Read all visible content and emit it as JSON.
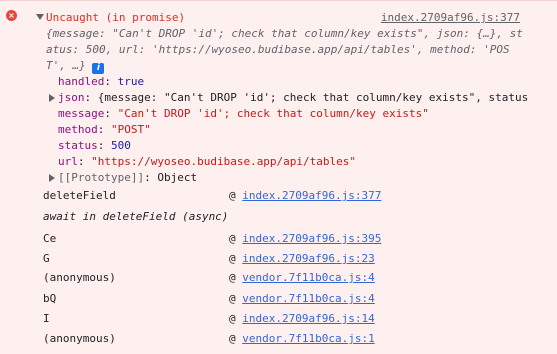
{
  "error": {
    "title": "Uncaught (in promise)",
    "source": "index.2709af96.js:377",
    "summary_line1": "{message: \"Can't DROP 'id'; check that column/key exists\", json: {…}, st",
    "summary_line2": "atus: 500, url: 'https://wyoseo.budibase.app/api/tables', method: 'POS",
    "summary_line3": "T', …}"
  },
  "properties": [
    {
      "key": "handled",
      "value": "true"
    },
    {
      "key": "json",
      "value": "{message: \"Can't DROP 'id'; check that column/key exists\", status"
    },
    {
      "key": "message",
      "value": "\"Can't DROP 'id'; check that column/key exists\""
    },
    {
      "key": "method",
      "value": "\"POST\""
    },
    {
      "key": "status",
      "value": "500"
    },
    {
      "key": "url",
      "value": "\"https://wyoseo.budibase.app/api/tables\""
    },
    {
      "key": "[[Prototype]]",
      "value": "Object"
    }
  ],
  "stack": [
    {
      "fn": "deleteField",
      "at": "@",
      "link": "index.2709af96.js:377"
    },
    {
      "fn": "await in deleteField (async)",
      "at": "",
      "link": ""
    },
    {
      "fn": "Ce",
      "at": "@",
      "link": "index.2709af96.js:395"
    },
    {
      "fn": "G",
      "at": "@",
      "link": "index.2709af96.js:23"
    },
    {
      "fn": "(anonymous)",
      "at": "@",
      "link": "vendor.7f11b0ca.js:4"
    },
    {
      "fn": "bQ",
      "at": "@",
      "link": "vendor.7f11b0ca.js:4"
    },
    {
      "fn": "I",
      "at": "@",
      "link": "index.2709af96.js:14"
    },
    {
      "fn": "(anonymous)",
      "at": "@",
      "link": "vendor.7f11b0ca.js:1"
    }
  ],
  "icons": {
    "error": "error-icon",
    "info": "info-icon"
  },
  "colors": {
    "error_text": "#d93025",
    "error_bg": "#fff0f0",
    "link": "#3367d6"
  }
}
